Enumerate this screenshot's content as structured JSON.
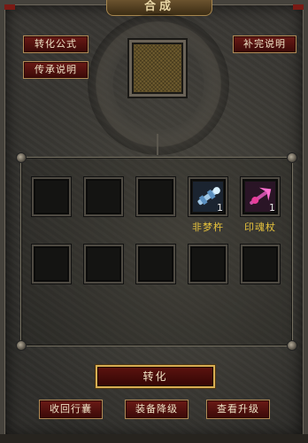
{
  "window": {
    "title": "合成"
  },
  "buttons": {
    "formula": "转化公式",
    "inherit": "传承说明",
    "supplement": "补完说明",
    "convert": "转化",
    "return_bag": "收回行囊",
    "downgrade": "装备降级",
    "view_upgrade": "查看升级"
  },
  "slots": {
    "row1": [
      {
        "item": "",
        "count": ""
      },
      {
        "item": "",
        "count": ""
      },
      {
        "item": "",
        "count": ""
      },
      {
        "item": "非梦杵",
        "count": "1",
        "icon": "pestle-icon"
      },
      {
        "item": "印魂杖",
        "count": "1",
        "icon": "staff-icon"
      }
    ],
    "row2": [
      {
        "item": "",
        "count": ""
      },
      {
        "item": "",
        "count": ""
      },
      {
        "item": "",
        "count": ""
      },
      {
        "item": "",
        "count": ""
      },
      {
        "item": "",
        "count": ""
      }
    ]
  },
  "colors": {
    "item_name": "#e6c23c",
    "button_red": "#5c130f",
    "border_gold": "#d8ae52"
  }
}
